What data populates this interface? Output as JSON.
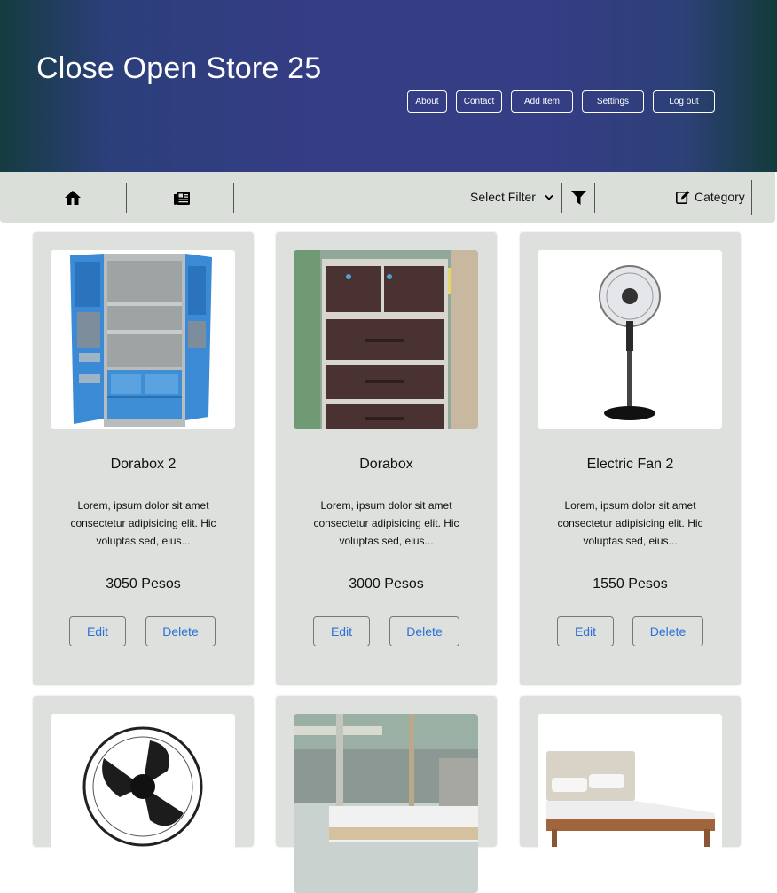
{
  "header": {
    "title": "Close Open Store 25",
    "nav": [
      "About",
      "Contact",
      "Add Item",
      "Settings",
      "Log out"
    ]
  },
  "toolbar": {
    "filter_label": "Select Filter",
    "category_label": "Category",
    "icons": [
      "home-icon",
      "newspaper-icon",
      "chevron-down-icon",
      "filter-icon",
      "edit-icon"
    ]
  },
  "products": [
    {
      "name": "Dorabox 2",
      "description": "Lorem, ipsum dolor sit amet consectetur adipisicing elit. Hic voluptas sed, eius...",
      "price": "3050 Pesos",
      "edit": "Edit",
      "delete": "Delete",
      "image": "blue-cabinet"
    },
    {
      "name": "Dorabox",
      "description": "Lorem, ipsum dolor sit amet consectetur adipisicing elit. Hic voluptas sed, eius...",
      "price": "3000 Pesos",
      "edit": "Edit",
      "delete": "Delete",
      "image": "brown-drawers"
    },
    {
      "name": "Electric Fan 2",
      "description": "Lorem, ipsum dolor sit amet consectetur adipisicing elit. Hic voluptas sed, eius...",
      "price": "1550 Pesos",
      "edit": "Edit",
      "delete": "Delete",
      "image": "stand-fan"
    },
    {
      "image": "wall-fan"
    },
    {
      "image": "bed-outdoor"
    },
    {
      "image": "bed-wooden"
    }
  ],
  "colors": {
    "header_mid": "#353d85",
    "toolbar_bg": "#dadfda",
    "card_bg": "#dde0dc",
    "link_blue": "#2e6fd8"
  }
}
